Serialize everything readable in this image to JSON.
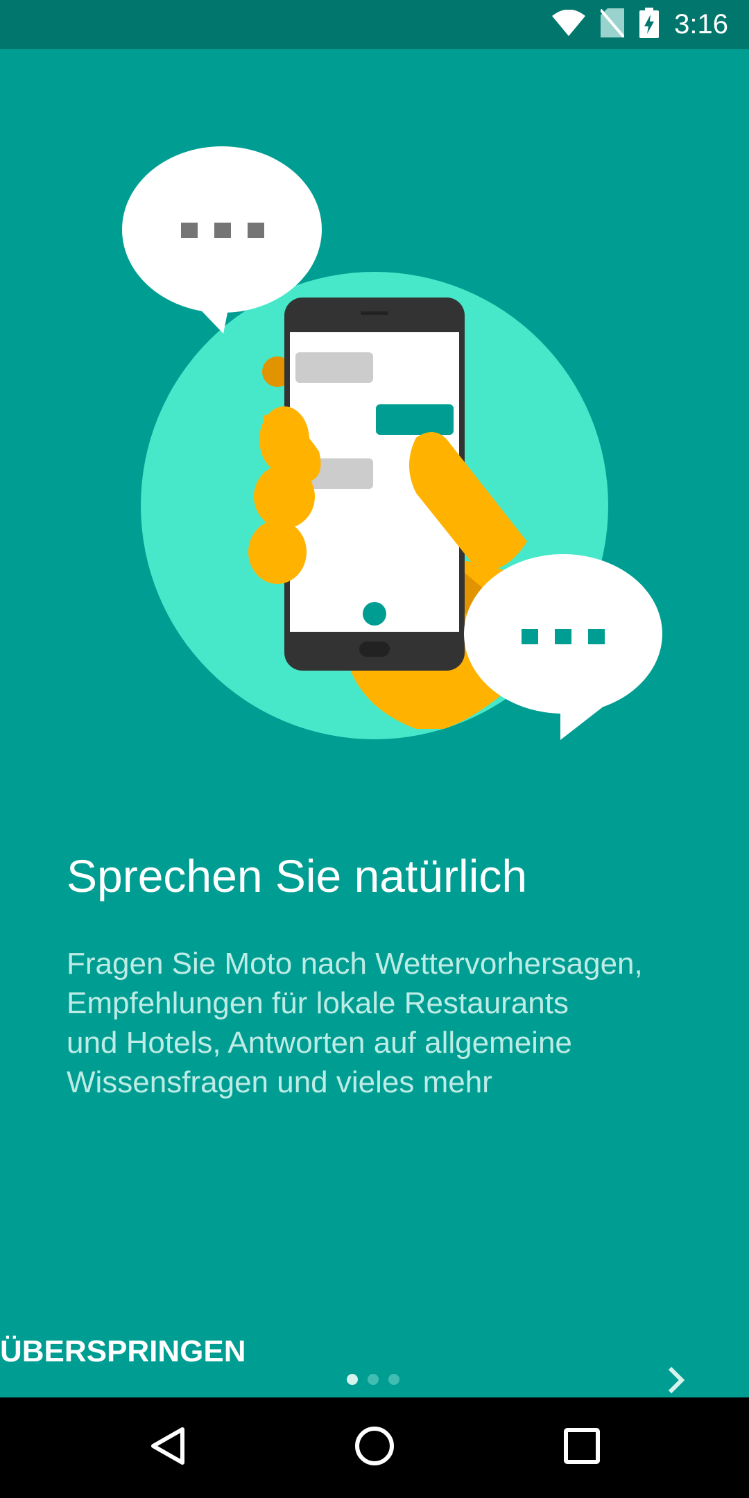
{
  "status_bar": {
    "time": "3:16",
    "icons": [
      "wifi-icon",
      "no-sim-icon",
      "battery-charging-icon"
    ]
  },
  "onboarding": {
    "headline": "Sprechen Sie natürlich",
    "body": "Fragen Sie Moto nach Wettervorhersagen,\nEmpfehlungen für lokale Restaurants\nund Hotels, Antworten auf allgemeine\nWissensfragen und vieles mehr",
    "illustration": "hand-holding-phone-with-chat-bubbles",
    "page_indicator": {
      "current": 1,
      "total": 3
    }
  },
  "controls": {
    "skip_label": "ÜBERSPRINGEN",
    "next_icon": "chevron-right-icon"
  },
  "navigation_bar": {
    "buttons": [
      "back-icon",
      "home-icon",
      "recents-icon"
    ]
  },
  "colors": {
    "background": "#009e92",
    "status_bar": "#00766c",
    "circle": "#47e8ca",
    "hand": "#ffb300",
    "phone": "#333333"
  }
}
